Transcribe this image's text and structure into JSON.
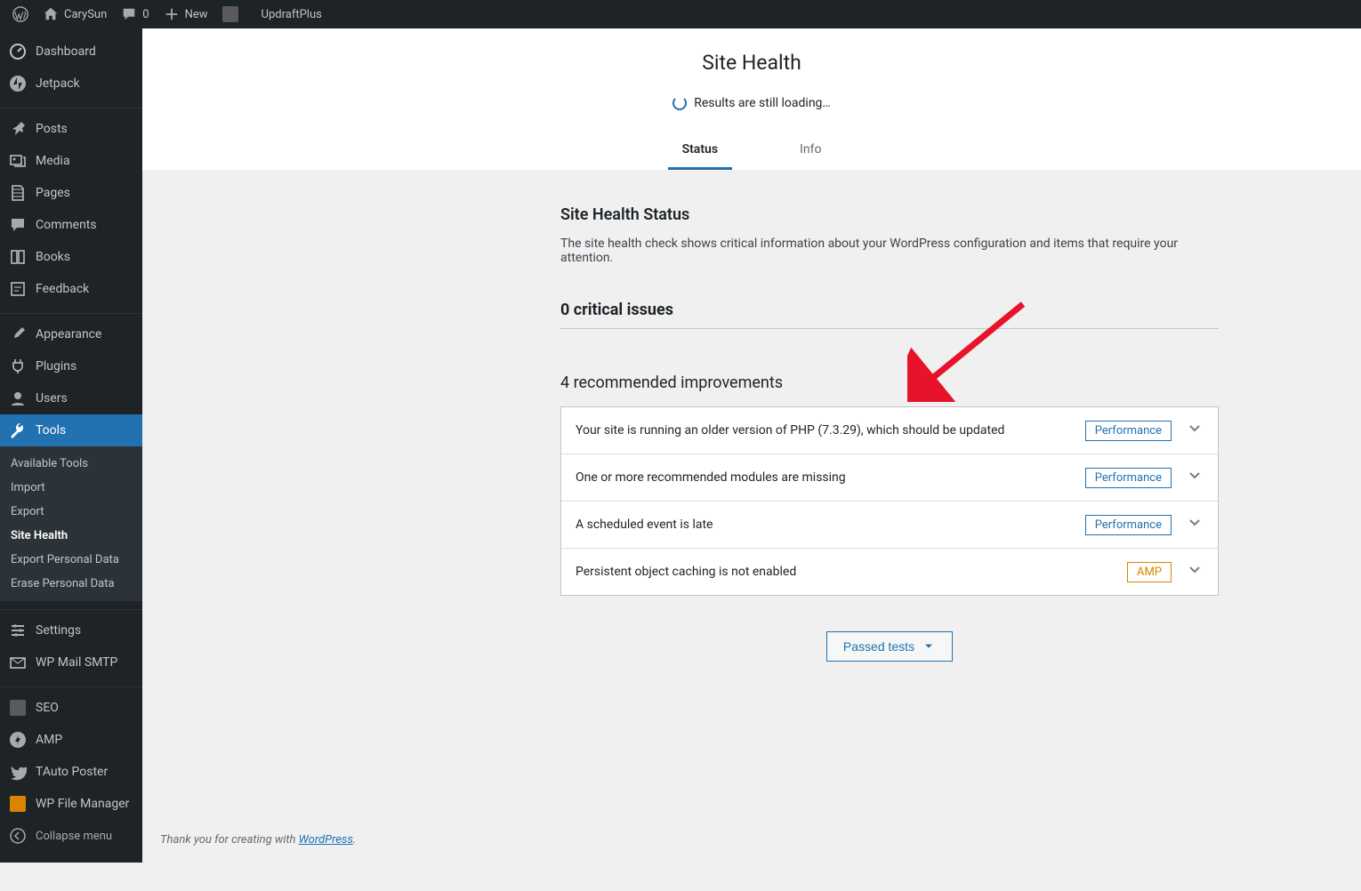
{
  "adminbar": {
    "site_name": "CarySun",
    "comments_count": "0",
    "new_label": "New",
    "updraft_label": "UpdraftPlus"
  },
  "sidebar": {
    "items": [
      {
        "label": "Dashboard",
        "icon": "dashboard"
      },
      {
        "label": "Jetpack",
        "icon": "jetpack"
      },
      {
        "label": "Posts",
        "icon": "pin"
      },
      {
        "label": "Media",
        "icon": "media"
      },
      {
        "label": "Pages",
        "icon": "page"
      },
      {
        "label": "Comments",
        "icon": "comment"
      },
      {
        "label": "Books",
        "icon": "book"
      },
      {
        "label": "Feedback",
        "icon": "feedback"
      },
      {
        "label": "Appearance",
        "icon": "brush"
      },
      {
        "label": "Plugins",
        "icon": "plug"
      },
      {
        "label": "Users",
        "icon": "user"
      },
      {
        "label": "Tools",
        "icon": "wrench",
        "current": true
      },
      {
        "label": "Settings",
        "icon": "settings"
      },
      {
        "label": "WP Mail SMTP",
        "icon": "mail"
      },
      {
        "label": "SEO",
        "icon": "yoast"
      },
      {
        "label": "AMP",
        "icon": "amp"
      },
      {
        "label": "TAuto Poster",
        "icon": "twitter"
      },
      {
        "label": "WP File Manager",
        "icon": "folder"
      }
    ],
    "submenu": [
      {
        "label": "Available Tools"
      },
      {
        "label": "Import"
      },
      {
        "label": "Export"
      },
      {
        "label": "Site Health",
        "current": true
      },
      {
        "label": "Export Personal Data"
      },
      {
        "label": "Erase Personal Data"
      }
    ],
    "collapse_label": "Collapse menu"
  },
  "health": {
    "title": "Site Health",
    "loading": "Results are still loading…",
    "tabs": {
      "status": "Status",
      "info": "Info"
    },
    "status_heading": "Site Health Status",
    "status_desc": "The site health check shows critical information about your WordPress configuration and items that require your attention.",
    "critical_heading": "0 critical issues",
    "rec_heading": "4 recommended improvements",
    "issues": [
      {
        "title": "Your site is running an older version of PHP (7.3.29), which should be updated",
        "badge": "Performance",
        "badge_type": "perf"
      },
      {
        "title": "One or more recommended modules are missing",
        "badge": "Performance",
        "badge_type": "perf"
      },
      {
        "title": "A scheduled event is late",
        "badge": "Performance",
        "badge_type": "perf"
      },
      {
        "title": "Persistent object caching is not enabled",
        "badge": "AMP",
        "badge_type": "amp"
      }
    ],
    "passed_label": "Passed tests"
  },
  "footer": {
    "thank_prefix": "Thank you for creating with ",
    "wp_link": "WordPress",
    "thank_suffix": "."
  }
}
